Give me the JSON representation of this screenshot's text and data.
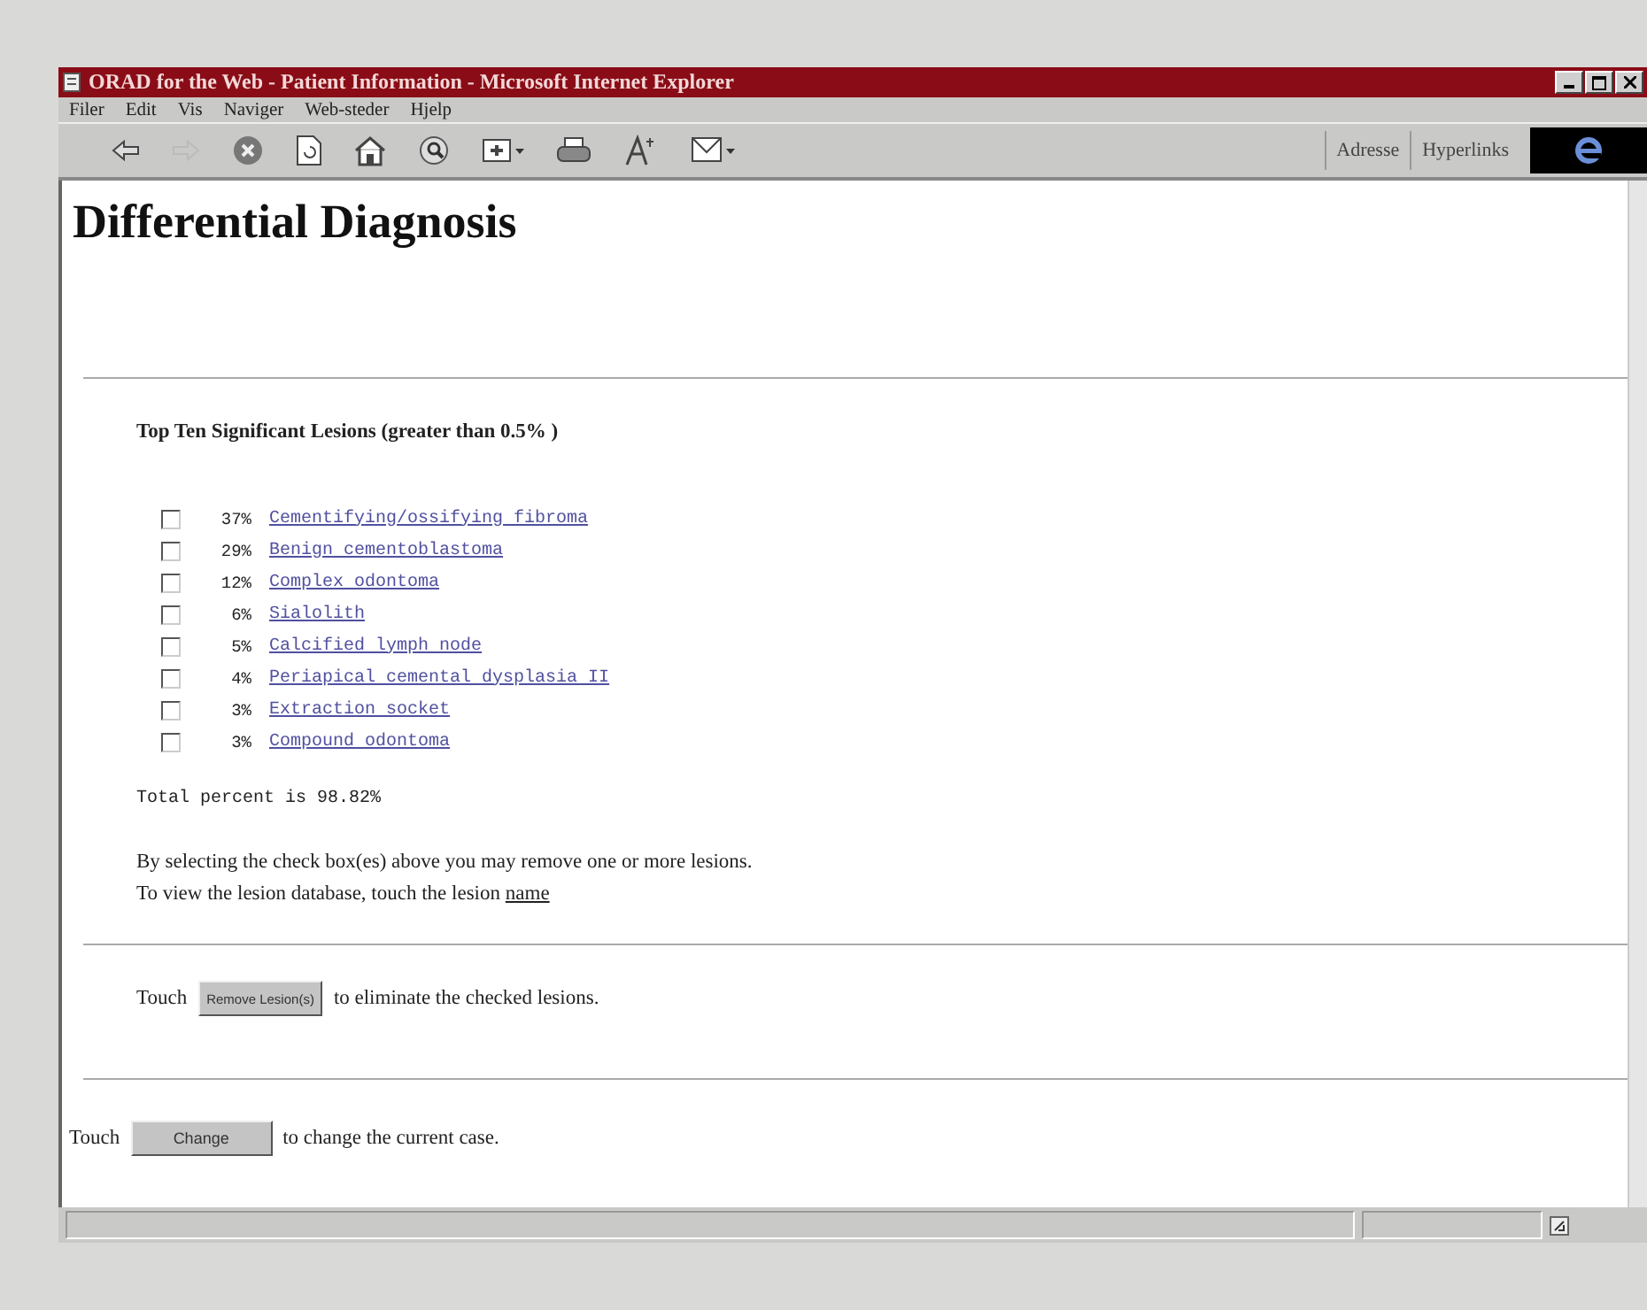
{
  "window": {
    "title": "ORAD for the Web - Patient Information - Microsoft Internet Explorer"
  },
  "menu": [
    "Filer",
    "Edit",
    "Vis",
    "Naviger",
    "Web-steder",
    "Hjelp"
  ],
  "toolbar": {
    "links": [
      "Adresse",
      "Hyperlinks"
    ]
  },
  "page": {
    "heading": "Differential Diagnosis",
    "subheading": "Top Ten Significant Lesions (greater than 0.5% )",
    "lesions": [
      {
        "percent": "37%",
        "name": "Cementifying/ossifying fibroma",
        "checked": false
      },
      {
        "percent": "29%",
        "name": "Benign cementoblastoma",
        "checked": false
      },
      {
        "percent": "12%",
        "name": "Complex odontoma",
        "checked": false
      },
      {
        "percent": "6%",
        "name": "Sialolith",
        "checked": false
      },
      {
        "percent": "5%",
        "name": "Calcified lymph node",
        "checked": false
      },
      {
        "percent": "4%",
        "name": "Periapical cemental dysplasia II",
        "checked": false
      },
      {
        "percent": "3%",
        "name": "Extraction socket",
        "checked": false
      },
      {
        "percent": "3%",
        "name": "Compound odontoma",
        "checked": false
      }
    ],
    "total": "Total percent is  98.82%",
    "note": "By selecting the check box(es) above you may remove one or more lesions.",
    "view_note": {
      "text": "To view the lesion database, touch the lesion",
      "link": "name"
    },
    "remove_row": {
      "before": "Touch",
      "button": "Remove Lesion(s)",
      "after": "to eliminate the checked lesions."
    },
    "change_row": {
      "before": "Touch",
      "button": "Change",
      "after": "to change the current case."
    }
  }
}
